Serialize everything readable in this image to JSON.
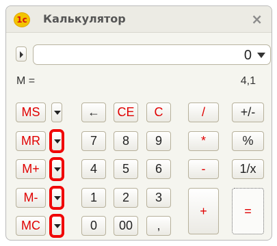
{
  "window": {
    "title": "Калькулятор",
    "logo_text": "1c",
    "close_symbol": "×"
  },
  "display": {
    "value": "0"
  },
  "memory": {
    "label": "M =",
    "value": "4,1"
  },
  "buttons": {
    "ms": "MS",
    "mr": "MR",
    "mplus": "M+",
    "mminus": "M-",
    "mc": "MC",
    "backspace": "←",
    "ce": "CE",
    "c": "C",
    "div": "/",
    "plusminus": "+/-",
    "seven": "7",
    "eight": "8",
    "nine": "9",
    "mul": "*",
    "percent": "%",
    "four": "4",
    "five": "5",
    "six": "6",
    "minus": "-",
    "reciprocal": "1/x",
    "one": "1",
    "two": "2",
    "three": "3",
    "plus": "+",
    "zero": "0",
    "doublezero": "00",
    "comma": ",",
    "equals": "="
  },
  "colors": {
    "red_labels": "#e00000",
    "highlight": "#f00000"
  }
}
